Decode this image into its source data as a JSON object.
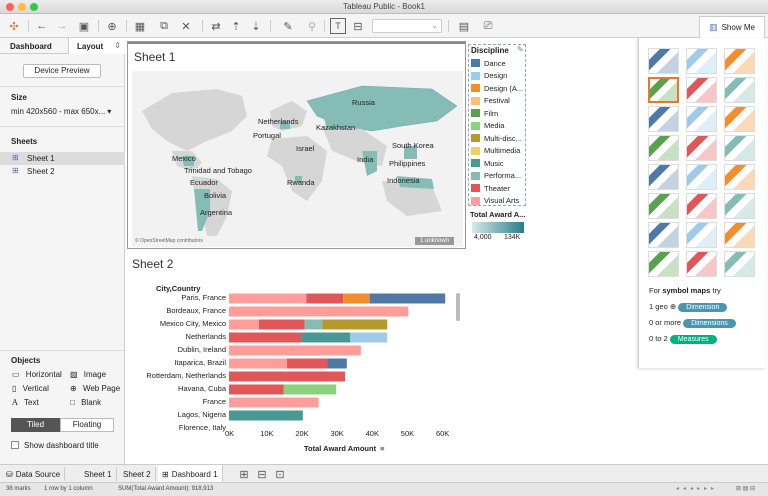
{
  "window": {
    "title": "Tableau Public - Book1"
  },
  "left": {
    "tabs": {
      "dashboard": "Dashboard",
      "layout": "Layout"
    },
    "device_preview": "Device Preview",
    "size_title": "Size",
    "size_value": "min 420x560 - max 650x...",
    "sheets_title": "Sheets",
    "sheets": [
      "Sheet 1",
      "Sheet 2"
    ],
    "objects_title": "Objects",
    "objects": [
      "Horizontal",
      "Image",
      "Vertical",
      "Web Page",
      "Text",
      "Blank"
    ],
    "tiled": "Tiled",
    "floating": "Floating",
    "show_title": "Show dashboard title"
  },
  "sheet1": {
    "title": "Sheet 1",
    "attribution": "© OpenStreetMap contributors",
    "unknown": "1 unknown",
    "labels": [
      "Russia",
      "Netherlands",
      "Portugal",
      "Kazakhstan",
      "Israel",
      "South Korea",
      "Mexico",
      "Trinidad and Tobago",
      "India",
      "Philippines",
      "Ecuador",
      "Rwanda",
      "Indonesia",
      "Bolivia",
      "Argentina"
    ]
  },
  "legend": {
    "title": "Discipline",
    "items": [
      {
        "label": "Dance",
        "color": "#4e79a7"
      },
      {
        "label": "Design",
        "color": "#a0cbe8"
      },
      {
        "label": "Design (A...",
        "color": "#f28e2b"
      },
      {
        "label": "Festival",
        "color": "#ffbe7d"
      },
      {
        "label": "Film",
        "color": "#59a14f"
      },
      {
        "label": "Media",
        "color": "#8cd17d"
      },
      {
        "label": "Multi-disc...",
        "color": "#b6992d"
      },
      {
        "label": "Multimedia",
        "color": "#f1ce63"
      },
      {
        "label": "Music",
        "color": "#499894"
      },
      {
        "label": "Performa...",
        "color": "#86bcb6"
      },
      {
        "label": "Theater",
        "color": "#e15759"
      },
      {
        "label": "Visual Arts",
        "color": "#ff9d9a"
      }
    ],
    "award_title": "Total Award A...",
    "award_min": "4,000",
    "award_max": "134K"
  },
  "sheet2": {
    "title": "Sheet 2",
    "row_header": "City,Country",
    "xaxis_title": "Total Award Amount"
  },
  "chart_data": {
    "type": "bar",
    "stacked": true,
    "orientation": "horizontal",
    "categories": [
      "Paris, France",
      "Bordeaux, France",
      "Mexico City, Mexico",
      "Netherlands",
      "Dublin, Ireland",
      "Itaparica, Brazil",
      "Rotterdam, Netherlands",
      "Havana, Cuba",
      "France",
      "Lagos, Nigeria",
      "Florence, Italy"
    ],
    "xticks": [
      "0K",
      "10K",
      "20K",
      "30K",
      "40K",
      "50K",
      "60K"
    ],
    "xlim": [
      0,
      62000
    ],
    "segments": [
      [
        {
          "color": "#ff9d9a",
          "value": 22000
        },
        {
          "color": "#e15759",
          "value": 10500
        },
        {
          "color": "#f28e2b",
          "value": 7500
        },
        {
          "color": "#4e79a7",
          "value": 21500
        }
      ],
      [
        {
          "color": "#ff9d9a",
          "value": 51000
        }
      ],
      [
        {
          "color": "#ff9d9a",
          "value": 8500
        },
        {
          "color": "#e15759",
          "value": 13000
        },
        {
          "color": "#86bcb6",
          "value": 5000
        },
        {
          "color": "#b6992d",
          "value": 18500
        }
      ],
      [
        {
          "color": "#e15759",
          "value": 20500
        },
        {
          "color": "#499894",
          "value": 14000
        },
        {
          "color": "#a0cbe8",
          "value": 10500
        }
      ],
      [
        {
          "color": "#ff9d9a",
          "value": 37500
        }
      ],
      [
        {
          "color": "#ff9d9a",
          "value": 16500
        },
        {
          "color": "#e15759",
          "value": 11500
        },
        {
          "color": "#4e79a7",
          "value": 5500
        }
      ],
      [
        {
          "color": "#e15759",
          "value": 33000
        }
      ],
      [
        {
          "color": "#e15759",
          "value": 15500
        },
        {
          "color": "#8cd17d",
          "value": 15000
        }
      ],
      [
        {
          "color": "#ff9d9a",
          "value": 25500
        }
      ],
      [
        {
          "color": "#499894",
          "value": 21000
        }
      ],
      [
        {
          "color": "#e15759",
          "value": 20500
        }
      ]
    ]
  },
  "tabs": {
    "datasource": "Data Source",
    "sheet1": "Sheet 1",
    "sheet2": "Sheet 2",
    "dashboard": "Dashboard 1"
  },
  "status": {
    "marks": "38 marks",
    "rows": "1 row by 1 column",
    "sum": "SUM(Total Award Amount): 918,913"
  },
  "showme": {
    "label": "Show Me",
    "hint_prefix": "For ",
    "hint_bold": "symbol maps",
    "hint_suffix": " try",
    "req": [
      {
        "label": "1 geo",
        "pill": "Dimension",
        "color": "#4996b2"
      },
      {
        "label": "0 or more",
        "pill": "Dimensions",
        "color": "#4996b2"
      },
      {
        "label": "0 to 2",
        "pill": "Measures",
        "color": "#00b180"
      }
    ]
  }
}
